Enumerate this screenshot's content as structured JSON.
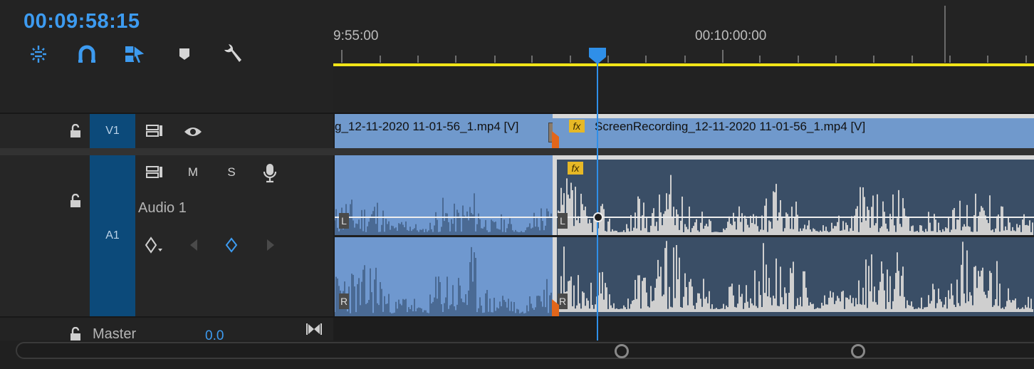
{
  "timecode": "00:09:58:15",
  "toolbar": {
    "tools": [
      {
        "name": "insert-overwrite-nest-icon",
        "active": true
      },
      {
        "name": "snap-magnet-icon",
        "active": true
      },
      {
        "name": "linked-selection-icon",
        "active": true
      },
      {
        "name": "add-marker-icon",
        "active": false
      },
      {
        "name": "timeline-settings-wrench-icon",
        "active": false
      }
    ]
  },
  "ruler": {
    "labels": [
      "9:55:00",
      "00:10:00:00"
    ]
  },
  "tracks": {
    "v1": {
      "target_label": "V1"
    },
    "a1": {
      "target_label": "A1",
      "name": "Audio 1",
      "mute": "M",
      "solo": "S"
    },
    "master": {
      "name": "Master",
      "value": "0.0"
    }
  },
  "clips": {
    "video_left_label": "g_12-11-2020 11-01-56_1.mp4 [V]",
    "video_right_label": "ScreenRecording_12-11-2020 11-01-56_1.mp4 [V]",
    "fx_label": "fx",
    "channel_left": "L",
    "channel_right": "R"
  },
  "colors": {
    "accent": "#3d9bf0",
    "video_clip": "#7099cc",
    "audio_selected": "#6f98cf",
    "audio_bg": "#3a4e66",
    "waveform": "#cfcfcf",
    "work_area": "#f1e418",
    "playhead": "#2f8fe8"
  }
}
